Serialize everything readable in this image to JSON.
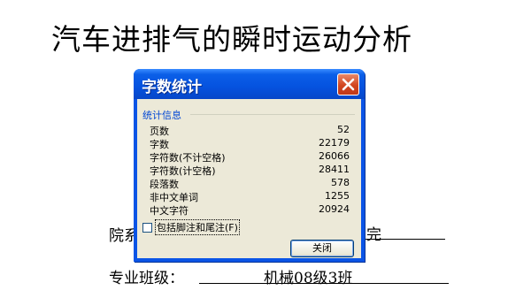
{
  "document": {
    "title": "汽车进排气的瞬时运动分析",
    "department_label": "院系",
    "department_tail": "完",
    "major_label": "专业班级：",
    "major_value": "机械08级3班"
  },
  "dialog": {
    "title": "字数统计",
    "group_label": "统计信息",
    "stats": [
      {
        "label": "页数",
        "value": "52"
      },
      {
        "label": "字数",
        "value": "22179"
      },
      {
        "label": "字符数(不计空格)",
        "value": "26066"
      },
      {
        "label": "字符数(计空格)",
        "value": "28411"
      },
      {
        "label": "段落数",
        "value": "578"
      },
      {
        "label": "非中文单词",
        "value": "1255"
      },
      {
        "label": "中文字符",
        "value": "20924"
      }
    ],
    "checkbox_label": "包括脚注和尾注(F)",
    "checkbox_checked": false,
    "close_button_label": "关闭"
  },
  "colors": {
    "titlebar": "#0552df",
    "close_button": "#d2451f",
    "dialog_body": "#ece9d8",
    "group_label": "#0046d5"
  }
}
